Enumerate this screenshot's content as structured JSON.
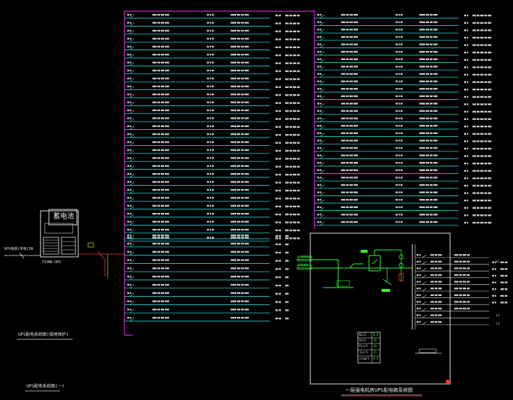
{
  "ups": {
    "battery_label": "蓄电池",
    "battery_caption": "",
    "input_label": "UPS电源(市电)IN",
    "model_label": "TIIMA UPS",
    "title_1": "UPS配电系统图(接地保护)",
    "title_2": "UPS配电系统图(一)"
  },
  "panel": {
    "title": "一层强电机房UPS配电箱系统图",
    "input_label_1": "主进线电源",
    "input_label_2": "UPS电源",
    "phase_labels": [
      "L1",
      "L2",
      "L3"
    ],
    "table_rows": [
      [
        "Kx/1",
        "0.8"
      ],
      [
        "Pe/1",
        "10"
      ],
      [
        "Pjs/1",
        "10"
      ],
      [
        "Ijs/1",
        "15"
      ],
      [
        "cosφ/1",
        "0.8"
      ]
    ]
  },
  "colors": {
    "bus": "#ff33ff",
    "line": "#33ffff",
    "breaker": "#ffff33",
    "device": "#33ff33",
    "text": "#e8e8e8",
    "accent": "#ff3333"
  }
}
